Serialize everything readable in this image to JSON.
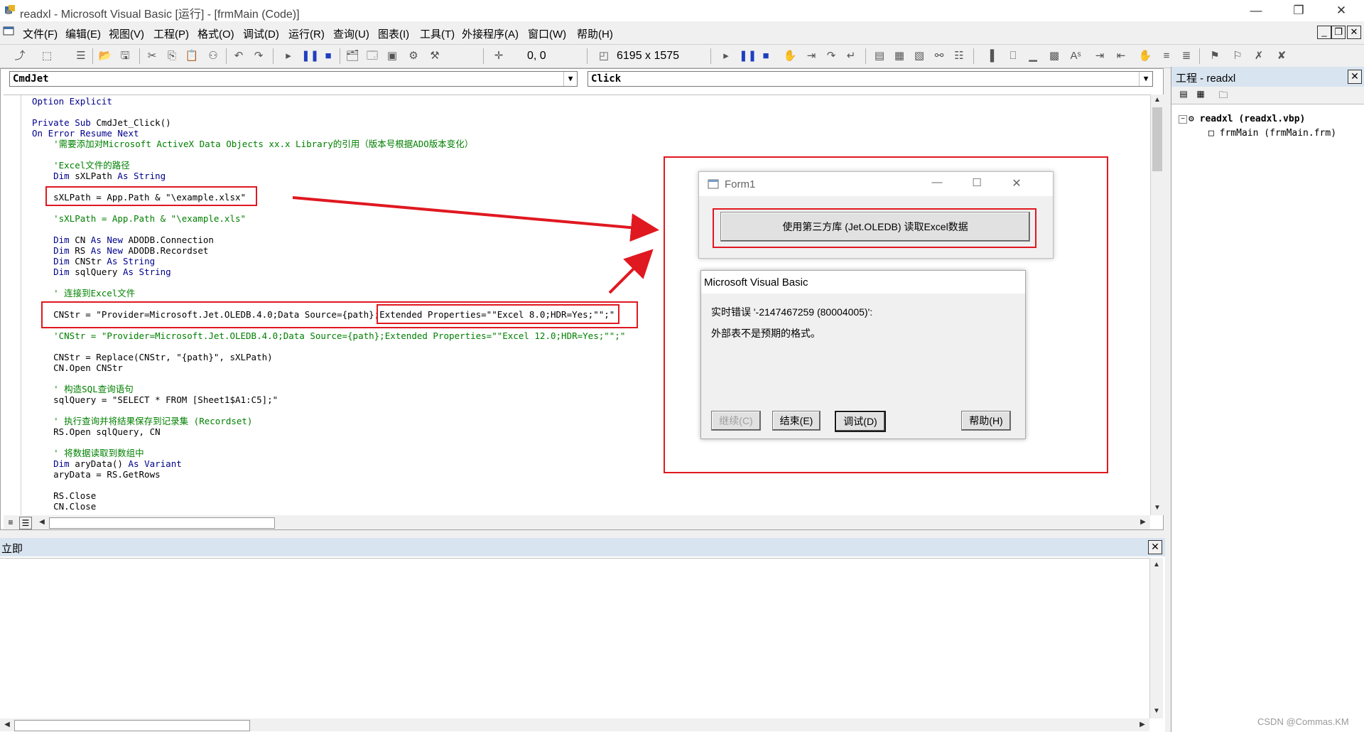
{
  "window": {
    "title": "readxl - Microsoft Visual Basic [运行] - [frmMain (Code)]"
  },
  "menu": [
    "文件(F)",
    "编辑(E)",
    "视图(V)",
    "工程(P)",
    "格式(O)",
    "调试(D)",
    "运行(R)",
    "查询(U)",
    "图表(I)",
    "工具(T)",
    "外接程序(A)",
    "窗口(W)",
    "帮助(H)"
  ],
  "toolbar": {
    "position": "0, 0",
    "size": "6195 x 1575"
  },
  "code_window": {
    "object_combo": "CmdJet",
    "proc_combo": "Click",
    "lines": [
      "Option Explicit",
      "",
      "Private Sub CmdJet_Click()",
      "On Error Resume Next",
      "    '需要添加对Microsoft ActiveX Data Objects xx.x Library的引用（版本号根据ADO版本变化）",
      "",
      "    'Excel文件的路径",
      "    Dim sXLPath As String",
      "",
      "    sXLPath = App.Path & \"\\example.xlsx\"",
      "",
      "    'sXLPath = App.Path & \"\\example.xls\"",
      "",
      "    Dim CN As New ADODB.Connection",
      "    Dim RS As New ADODB.Recordset",
      "    Dim CNStr As String",
      "    Dim sqlQuery As String",
      "",
      "    ' 连接到Excel文件",
      "",
      "    CNStr = \"Provider=Microsoft.Jet.OLEDB.4.0;Data Source={path};Extended Properties=\"\"Excel 8.0;HDR=Yes;\"\";\"",
      "",
      "    'CNStr = \"Provider=Microsoft.Jet.OLEDB.4.0;Data Source={path};Extended Properties=\"\"Excel 12.0;HDR=Yes;\"\";\"",
      "",
      "    CNStr = Replace(CNStr, \"{path}\", sXLPath)",
      "    CN.Open CNStr",
      "",
      "    ' 构造SQL查询语句",
      "    sqlQuery = \"SELECT * FROM [Sheet1$A1:C5];\"",
      "",
      "    ' 执行查询并将结果保存到记录集 (Recordset)",
      "    RS.Open sqlQuery, CN",
      "",
      "    ' 将数据读取到数组中",
      "    Dim aryData() As Variant",
      "    aryData = RS.GetRows",
      "",
      "    RS.Close",
      "    CN.Close"
    ]
  },
  "form1": {
    "title": "Form1",
    "button_label": "使用第三方库 (Jet.OLEDB) 读取Excel数据"
  },
  "msgbox": {
    "title": "Microsoft Visual Basic",
    "line1": "实时错误 '-2147467259 (80004005)':",
    "line2": "外部表不是预期的格式。",
    "buttons": {
      "continue": "继续(C)",
      "end": "结束(E)",
      "debug": "调试(D)",
      "help": "帮助(H)"
    }
  },
  "project": {
    "title": "工程 - readxl",
    "root": "readxl (readxl.vbp)",
    "child": "frmMain (frmMain.frm)"
  },
  "immediate": {
    "title": "立即"
  },
  "watermark": "CSDN @Commas.KM"
}
